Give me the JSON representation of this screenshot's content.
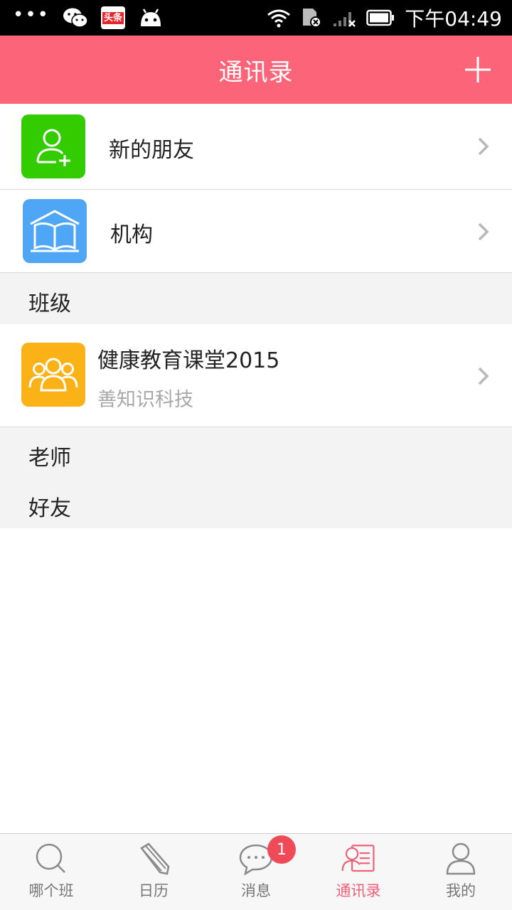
{
  "status_bar": {
    "dots": "•••",
    "toutiao_label": "头条",
    "time": "下午04:49"
  },
  "header": {
    "title": "通讯录"
  },
  "rows": [
    {
      "label": "新的朋友",
      "icon": "add-person-icon",
      "color": "#33cc00"
    },
    {
      "label": "机构",
      "icon": "book-house-icon",
      "color": "#4ea6f4"
    }
  ],
  "sections": {
    "class": "班级",
    "teacher": "老师",
    "friends": "好友"
  },
  "class_item": {
    "title": "健康教育课堂2015",
    "subtitle": "善知识科技",
    "icon": "group-icon",
    "color": "#fbb216"
  },
  "tabs": [
    {
      "label": "哪个班",
      "icon": "search-icon",
      "active": false
    },
    {
      "label": "日历",
      "icon": "pencil-icon",
      "active": false
    },
    {
      "label": "消息",
      "icon": "chat-bubble-icon",
      "active": false,
      "badge": "1"
    },
    {
      "label": "通讯录",
      "icon": "contacts-icon",
      "active": true
    },
    {
      "label": "我的",
      "icon": "person-icon",
      "active": false
    }
  ],
  "colors": {
    "accent": "#fc6479",
    "active_tab": "#f0627a",
    "badge": "#ef4a57"
  }
}
